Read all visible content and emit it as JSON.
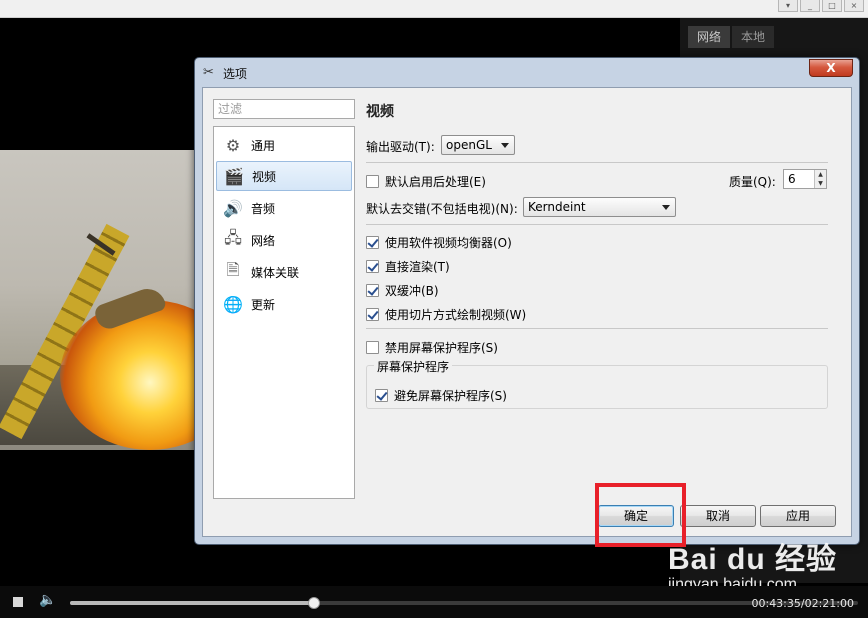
{
  "player": {
    "side_tabs": [
      "网络",
      "本地"
    ],
    "controls": {
      "time": "00:43:35/02:21:00",
      "progress": 0.31
    }
  },
  "dialog": {
    "title": "选项",
    "close_label": "X",
    "filter_placeholder": "过滤",
    "nav": [
      {
        "label": "通用",
        "icon": "gear-icon"
      },
      {
        "label": "视频",
        "icon": "clapperboard-icon"
      },
      {
        "label": "音频",
        "icon": "speaker-icon"
      },
      {
        "label": "网络",
        "icon": "network-icon"
      },
      {
        "label": "媒体关联",
        "icon": "media-association-icon"
      },
      {
        "label": "更新",
        "icon": "update-globe-icon"
      }
    ],
    "selected_nav": "视频",
    "section_title": "视频",
    "output_driver_label": "输出驱动(T):",
    "output_driver_value": "openGL",
    "postprocess_label": "默认启用后处理(E)",
    "postprocess_checked": false,
    "quality_label": "质量(Q):",
    "quality_value": "6",
    "deinterlace_label": "默认去交错(不包括电视)(N):",
    "deinterlace_value": "Kerndeint",
    "options": [
      {
        "label": "使用软件视频均衡器(O)",
        "checked": true
      },
      {
        "label": "直接渲染(T)",
        "checked": true
      },
      {
        "label": "双缓冲(B)",
        "checked": true
      },
      {
        "label": "使用切片方式绘制视频(W)",
        "checked": true
      }
    ],
    "disable_screensaver_label": "禁用屏幕保护程序(S)",
    "disable_screensaver_checked": false,
    "screensaver_group_title": "屏幕保护程序",
    "avoid_screensaver_label": "避免屏幕保护程序(S)",
    "avoid_screensaver_checked": true,
    "buttons": {
      "ok": "确定",
      "cancel": "取消",
      "apply": "应用"
    }
  },
  "watermark": {
    "logo": "Bai du 经验",
    "url": "jingyan.baidu.com"
  },
  "colors": {
    "highlight": "#e8202a",
    "dialog_frame": "#c6d3e4"
  }
}
